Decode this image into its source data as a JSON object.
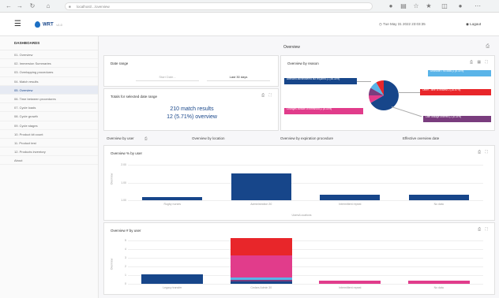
{
  "browser": {
    "url": "localhost/.../overview"
  },
  "app": {
    "name": "WRT",
    "version": "v1.0",
    "datetime": "Tue May 31 2022 23:03:35",
    "logout_label": "Logout"
  },
  "sidebar": {
    "heading": "DASHBOARDS",
    "items": [
      {
        "label": "01. Overview"
      },
      {
        "label": "02. Immersion Summaries"
      },
      {
        "label": "03. Overlapping procedures"
      },
      {
        "label": "04. Match results"
      },
      {
        "label": "05. Overview"
      },
      {
        "label": "06. Time between procedures"
      },
      {
        "label": "07. Cycle loads"
      },
      {
        "label": "08. Cycle growth"
      },
      {
        "label": "09. Cycle stages"
      },
      {
        "label": "10. Product kit count"
      },
      {
        "label": "11. Product test"
      },
      {
        "label": "12. Products inventory"
      },
      {
        "label": "About"
      }
    ]
  },
  "page": {
    "title": "Overview"
  },
  "date_range": {
    "title": "Date range",
    "start_placeholder": "Start Date...",
    "end_value": "Last 30 days"
  },
  "totals": {
    "title": "Totals for selected date range",
    "match_results": "210 match results",
    "overview": "12 (5.71%) overview"
  },
  "pie": {
    "title": "Overview by reason",
    "labels": [
      {
        "text": "Attended administered but required (1 (58.33%)",
        "color": "#17468a"
      },
      {
        "text": "Changes outside of threshold (1 (8.33%)",
        "color": "#e13c8b"
      },
      {
        "text": "Unknown / no data (1 (8.33%)",
        "color": "#5ab4e8"
      },
      {
        "text": "Other - time to nearest 2 (16.67%)",
        "color": "#e8262a"
      },
      {
        "text": "Late dosage ordered (1 (8.33%)",
        "color": "#7a3d7e"
      }
    ]
  },
  "tabs": [
    {
      "label": "Overview by user"
    },
    {
      "label": "Overview by location"
    },
    {
      "label": "Overview by expiration procedure"
    },
    {
      "label": "Effective overview date"
    }
  ],
  "colors": {
    "navy": "#17468a",
    "red": "#e8262a",
    "pink": "#e13c8b",
    "purple": "#7a3d7e",
    "lightblue": "#5ab4e8"
  },
  "chart_data": [
    {
      "type": "bar",
      "title": "Overview % by user",
      "categories": [
        "Rugby nurses",
        "Administration 30",
        "Intermittent repeat",
        "No data"
      ],
      "series": [
        {
          "values": [
            0.1,
            0.9,
            0.2,
            0.2
          ]
        }
      ],
      "yticks": [
        "2.00",
        "1.00",
        "1.00"
      ],
      "ylabel": "Overview",
      "xlabel": "Users/Locations",
      "ylim": [
        0,
        1.2
      ]
    },
    {
      "type": "bar",
      "title": "Overview # by user",
      "categories": [
        "Legacy transfer",
        "Cedars Admin 30",
        "Intermittent repeat",
        "No data"
      ],
      "series": [
        {
          "values": [
            1.1,
            0.25,
            0,
            0
          ],
          "color": "#17468a"
        },
        {
          "values": [
            0,
            0.25,
            0,
            0
          ],
          "color": "#7a3d7e"
        },
        {
          "values": [
            0,
            0.25,
            0,
            0
          ],
          "color": "#5ab4e8"
        },
        {
          "values": [
            0,
            2.5,
            0.35,
            0.35
          ],
          "color": "#e13c8b"
        },
        {
          "values": [
            0,
            2.0,
            0,
            0
          ],
          "color": "#e8262a"
        }
      ],
      "yticks": [
        "5",
        "4",
        "3",
        "2",
        "1",
        "0"
      ],
      "ylabel": "Overview",
      "ylim": [
        0,
        5
      ]
    }
  ]
}
